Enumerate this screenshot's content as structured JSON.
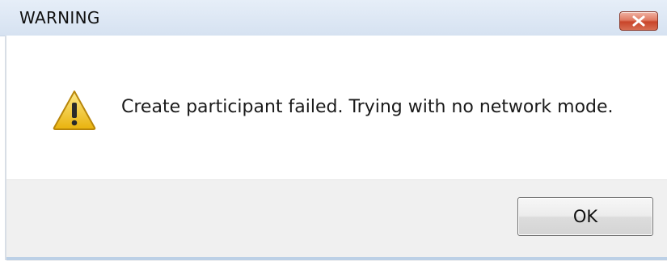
{
  "window": {
    "title": "WARNING",
    "close_icon": "close-icon"
  },
  "message": {
    "icon": "warning-icon",
    "text": "Create participant failed.  Trying with no network mode."
  },
  "buttons": {
    "ok_label": "OK"
  },
  "colors": {
    "title_bar": "#d6e2f1",
    "close_button": "#c9452b",
    "footer": "#f0f0f0",
    "warning_yellow": "#f5c518"
  }
}
